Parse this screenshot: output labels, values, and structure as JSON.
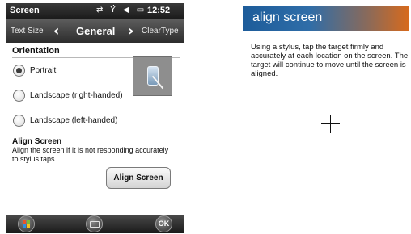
{
  "status_bar": {
    "title": "Screen",
    "icons": [
      "sync-icon",
      "signal-icon",
      "volume-icon",
      "battery-icon"
    ],
    "icon_glyphs": "⇄ Ÿ ◀ ▭",
    "time": "12:52"
  },
  "tabs": {
    "prev": "Text Size",
    "current": "General",
    "next": "ClearType"
  },
  "orientation": {
    "heading": "Orientation",
    "options": [
      {
        "label": "Portrait",
        "selected": true
      },
      {
        "label": "Landscape (right-handed)",
        "selected": false
      },
      {
        "label": "Landscape (left-handed)",
        "selected": false
      }
    ]
  },
  "align": {
    "heading": "Align Screen",
    "description": "Align the screen if it is not responding accurately to stylus taps.",
    "button_label": "Align Screen"
  },
  "softkeys": {
    "ok_label": "OK"
  },
  "calibration": {
    "title": "align screen",
    "instructions": "Using a stylus, tap the target firmly and accurately at each location on the screen. The target will continue to move until the screen is aligned."
  },
  "colors": {
    "header_blue": "#1d5c9a",
    "header_orange": "#d86a1c",
    "bar_dark": "#2c2c2c"
  }
}
